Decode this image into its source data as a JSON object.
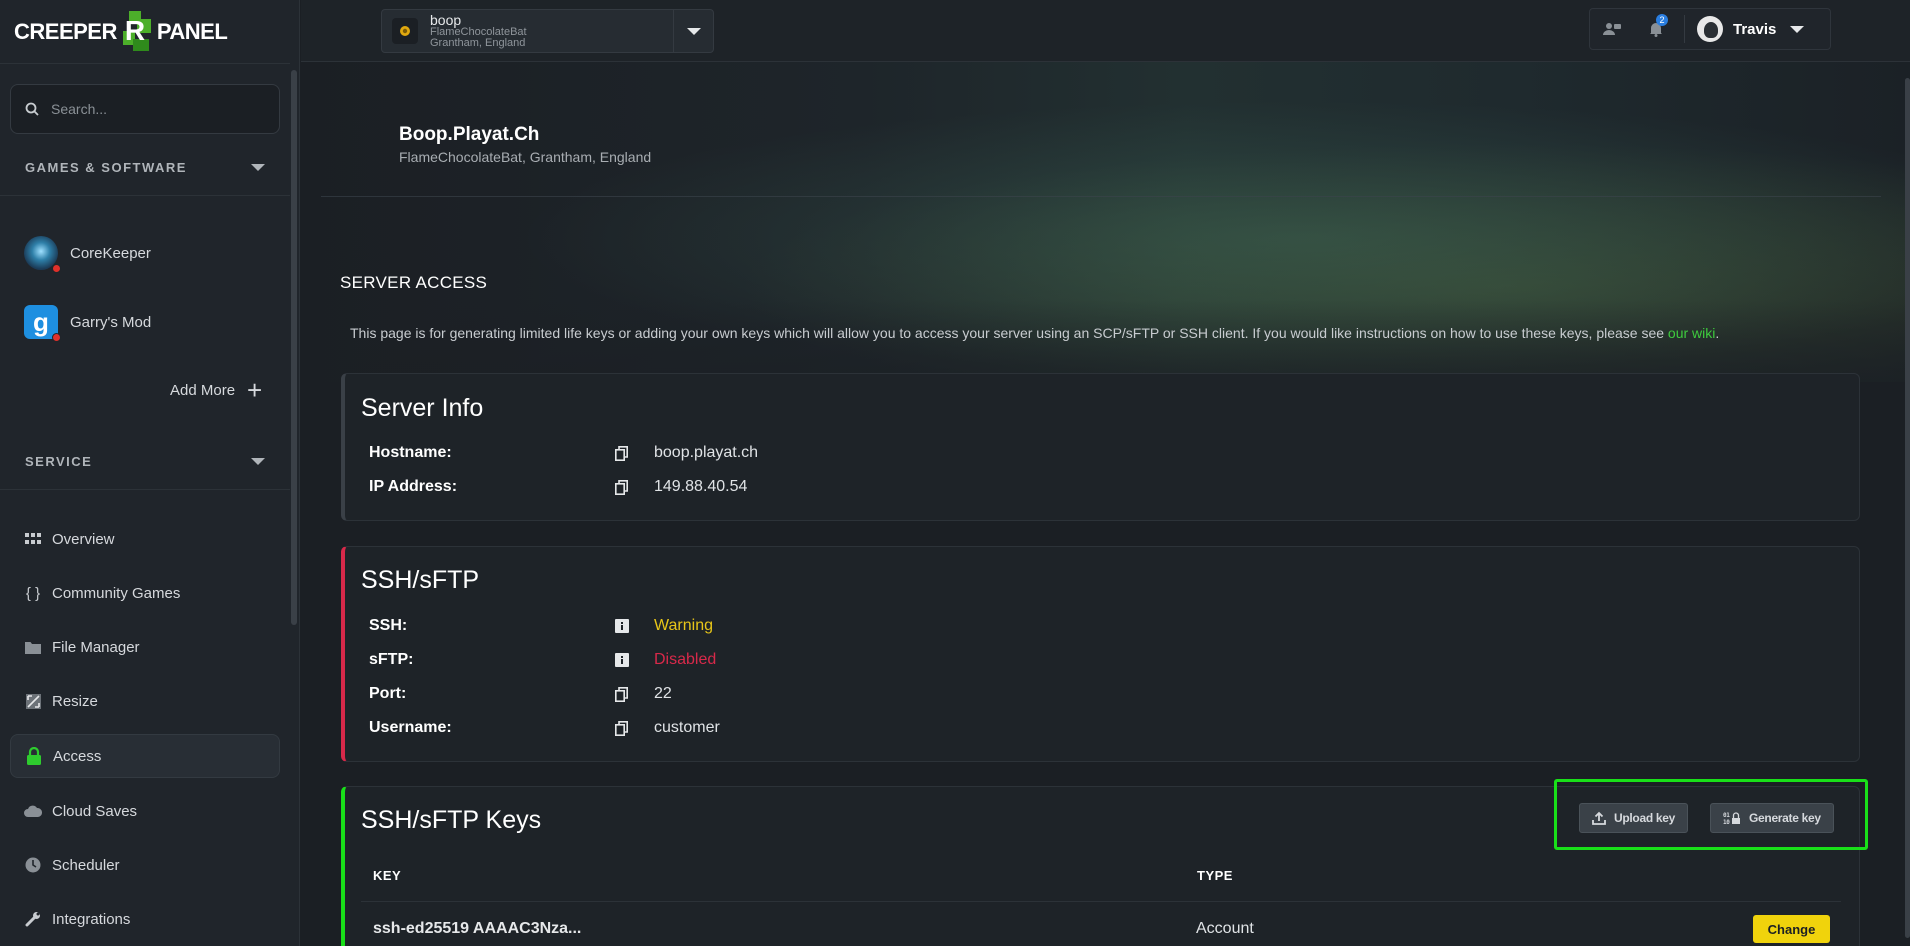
{
  "brand": {
    "left": "CREEPER",
    "mid": "R",
    "right": "PANEL"
  },
  "sidebar": {
    "search_placeholder": "Search...",
    "games_section": "GAMES & SOFTWARE",
    "games": [
      {
        "label": "CoreKeeper"
      },
      {
        "label": "Garry's Mod"
      }
    ],
    "add_more": "Add More",
    "service_section": "SERVICE",
    "nav": [
      {
        "label": "Overview",
        "icon": "grid-icon"
      },
      {
        "label": "Community Games",
        "icon": "braces-icon"
      },
      {
        "label": "File Manager",
        "icon": "folder-icon"
      },
      {
        "label": "Resize",
        "icon": "resize-icon"
      },
      {
        "label": "Access",
        "icon": "lock-icon"
      },
      {
        "label": "Cloud Saves",
        "icon": "cloud-icon"
      },
      {
        "label": "Scheduler",
        "icon": "clock-icon"
      },
      {
        "label": "Integrations",
        "icon": "wrench-icon"
      }
    ],
    "active": "Access"
  },
  "topbar": {
    "server_name": "boop",
    "server_sub1": "FlameChocolateBat",
    "server_sub2": "Grantham, England",
    "notification_count": "2",
    "user_name": "Travis"
  },
  "page": {
    "title": "Boop.Playat.Ch",
    "subtitle": "FlameChocolateBat, Grantham, England",
    "section_title": "SERVER ACCESS",
    "intro_text": "This page is for generating limited life keys or adding your own keys which will allow you to access your server using an SCP/sFTP or SSH client. If you would like instructions on how to use these keys, please see ",
    "intro_link": "our wiki",
    "intro_end": "."
  },
  "server_info": {
    "title": "Server Info",
    "hostname_label": "Hostname:",
    "hostname": "boop.playat.ch",
    "ip_label": "IP Address:",
    "ip": "149.88.40.54"
  },
  "ssh": {
    "title": "SSH/sFTP",
    "ssh_label": "SSH:",
    "ssh_status": "Warning",
    "sftp_label": "sFTP:",
    "sftp_status": "Disabled",
    "port_label": "Port:",
    "port": "22",
    "username_label": "Username:",
    "username": "customer"
  },
  "keys": {
    "title": "SSH/sFTP Keys",
    "upload_label": "Upload key",
    "generate_label": "Generate key",
    "col_key": "KEY",
    "col_type": "TYPE",
    "rows": [
      {
        "key": "ssh-ed25519 AAAAC3Nza...",
        "type": "Account",
        "action": "Change"
      }
    ]
  },
  "colors": {
    "accent_green": "#19e019",
    "warning": "#e8c619",
    "disabled": "#d8294a",
    "ssh_card_border": "#d8294a",
    "keys_card_border": "#19e019",
    "change_button": "#f0d30c"
  }
}
